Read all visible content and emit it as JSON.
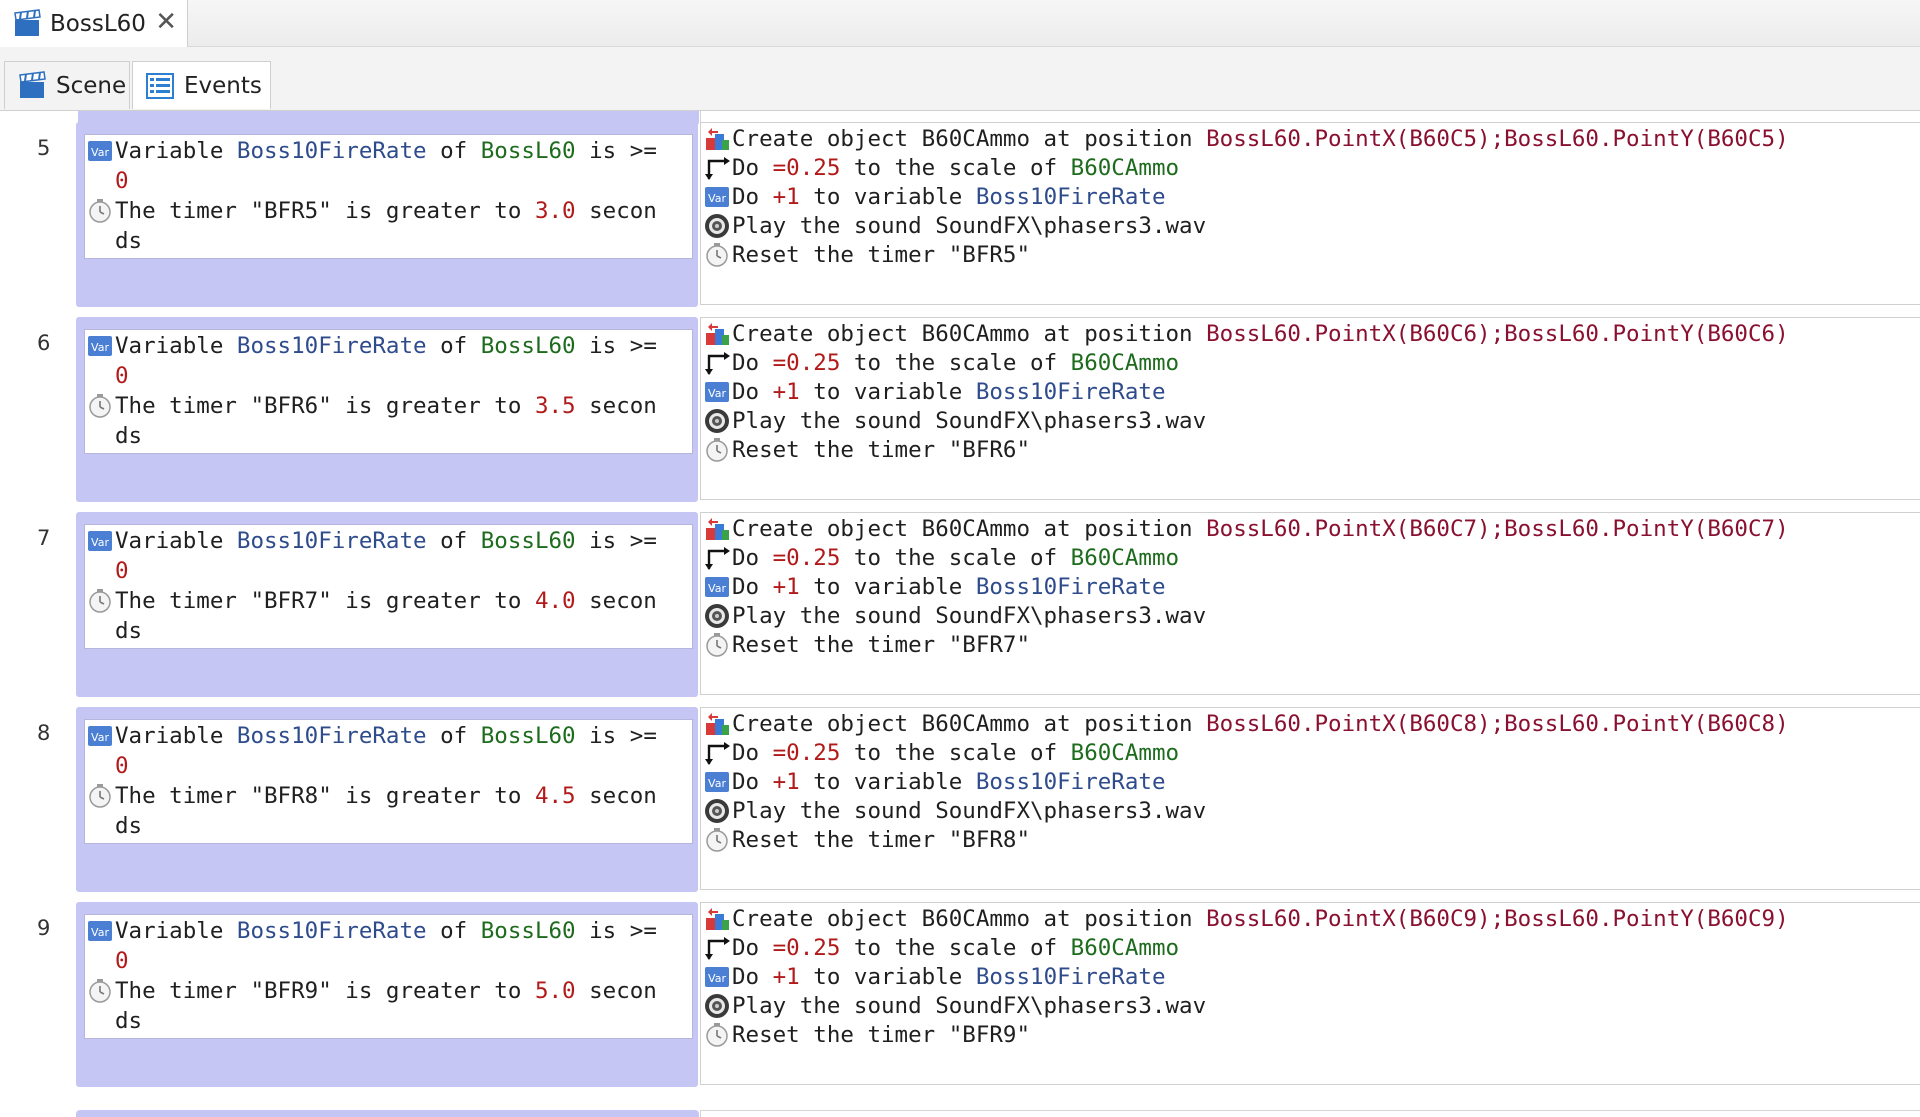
{
  "document_tab": {
    "title": "BossL60",
    "close": "✕"
  },
  "view_tabs": [
    {
      "label": "Scene"
    },
    {
      "label": "Events"
    }
  ],
  "events": [
    {
      "number": "5",
      "cond_var": {
        "prefix": "Variable ",
        "var": "Boss10FireRate",
        "of": " of ",
        "obj": "BossL60",
        "op": " is >=",
        "value": "0"
      },
      "cond_timer": {
        "part1": "The timer \"BFR5\" is greater to ",
        "secs": "3.0",
        "secon": " secon",
        "ds": "ds"
      },
      "create": {
        "text": "Create object B60CAmmo at position ",
        "pos": "BossL60.PointX(B60C5);BossL60.PointY(B60C5)"
      },
      "scale": {
        "do": "Do ",
        "val": "=0.25",
        "mid": " to the scale of ",
        "obj": "B60CAmmo"
      },
      "variable": {
        "do": "Do ",
        "val": "+1",
        "mid": " to variable ",
        "var": "Boss10FireRate"
      },
      "sound": {
        "text": "Play the sound SoundFX\\phasers3.wav"
      },
      "reset": {
        "text": "Reset the timer \"BFR5\""
      }
    },
    {
      "number": "6",
      "cond_var": {
        "prefix": "Variable ",
        "var": "Boss10FireRate",
        "of": " of ",
        "obj": "BossL60",
        "op": " is >=",
        "value": "0"
      },
      "cond_timer": {
        "part1": "The timer \"BFR6\" is greater to ",
        "secs": "3.5",
        "secon": " secon",
        "ds": "ds"
      },
      "create": {
        "text": "Create object B60CAmmo at position ",
        "pos": "BossL60.PointX(B60C6);BossL60.PointY(B60C6)"
      },
      "scale": {
        "do": "Do ",
        "val": "=0.25",
        "mid": " to the scale of ",
        "obj": "B60CAmmo"
      },
      "variable": {
        "do": "Do ",
        "val": "+1",
        "mid": " to variable ",
        "var": "Boss10FireRate"
      },
      "sound": {
        "text": "Play the sound SoundFX\\phasers3.wav"
      },
      "reset": {
        "text": "Reset the timer \"BFR6\""
      }
    },
    {
      "number": "7",
      "cond_var": {
        "prefix": "Variable ",
        "var": "Boss10FireRate",
        "of": " of ",
        "obj": "BossL60",
        "op": " is >=",
        "value": "0"
      },
      "cond_timer": {
        "part1": "The timer \"BFR7\" is greater to ",
        "secs": "4.0",
        "secon": " secon",
        "ds": "ds"
      },
      "create": {
        "text": "Create object B60CAmmo at position ",
        "pos": "BossL60.PointX(B60C7);BossL60.PointY(B60C7)"
      },
      "scale": {
        "do": "Do ",
        "val": "=0.25",
        "mid": " to the scale of ",
        "obj": "B60CAmmo"
      },
      "variable": {
        "do": "Do ",
        "val": "+1",
        "mid": " to variable ",
        "var": "Boss10FireRate"
      },
      "sound": {
        "text": "Play the sound SoundFX\\phasers3.wav"
      },
      "reset": {
        "text": "Reset the timer \"BFR7\""
      }
    },
    {
      "number": "8",
      "cond_var": {
        "prefix": "Variable ",
        "var": "Boss10FireRate",
        "of": " of ",
        "obj": "BossL60",
        "op": " is >=",
        "value": "0"
      },
      "cond_timer": {
        "part1": "The timer \"BFR8\" is greater to ",
        "secs": "4.5",
        "secon": " secon",
        "ds": "ds"
      },
      "create": {
        "text": "Create object B60CAmmo at position ",
        "pos": "BossL60.PointX(B60C8);BossL60.PointY(B60C8)"
      },
      "scale": {
        "do": "Do ",
        "val": "=0.25",
        "mid": " to the scale of ",
        "obj": "B60CAmmo"
      },
      "variable": {
        "do": "Do ",
        "val": "+1",
        "mid": " to variable ",
        "var": "Boss10FireRate"
      },
      "sound": {
        "text": "Play the sound SoundFX\\phasers3.wav"
      },
      "reset": {
        "text": "Reset the timer \"BFR8\""
      }
    },
    {
      "number": "9",
      "cond_var": {
        "prefix": "Variable ",
        "var": "Boss10FireRate",
        "of": " of ",
        "obj": "BossL60",
        "op": " is >=",
        "value": "0"
      },
      "cond_timer": {
        "part1": "The timer \"BFR9\" is greater to ",
        "secs": "5.0",
        "secon": " secon",
        "ds": "ds"
      },
      "create": {
        "text": "Create object B60CAmmo at position ",
        "pos": "BossL60.PointX(B60C9);BossL60.PointY(B60C9)"
      },
      "scale": {
        "do": "Do ",
        "val": "=0.25",
        "mid": " to the scale of ",
        "obj": "B60CAmmo"
      },
      "variable": {
        "do": "Do ",
        "val": "+1",
        "mid": " to variable ",
        "var": "Boss10FireRate"
      },
      "sound": {
        "text": "Play the sound SoundFX\\phasers3.wav"
      },
      "reset": {
        "text": "Reset the timer \"BFR9\""
      }
    }
  ],
  "icons": {
    "scene_tab": "clapperboard-icon",
    "events_tab": "list-icon",
    "variable": "variable-icon",
    "timer": "timer-icon",
    "create": "create-object-icon",
    "scale": "resize-arrow-icon",
    "sound": "speaker-icon"
  },
  "colors": {
    "condition_block": "#c6c6f4",
    "variable_name": "#2e4b8c",
    "object_name": "#1d6b1d",
    "number_value": "#b21a1a",
    "expression": "#8a1030"
  }
}
